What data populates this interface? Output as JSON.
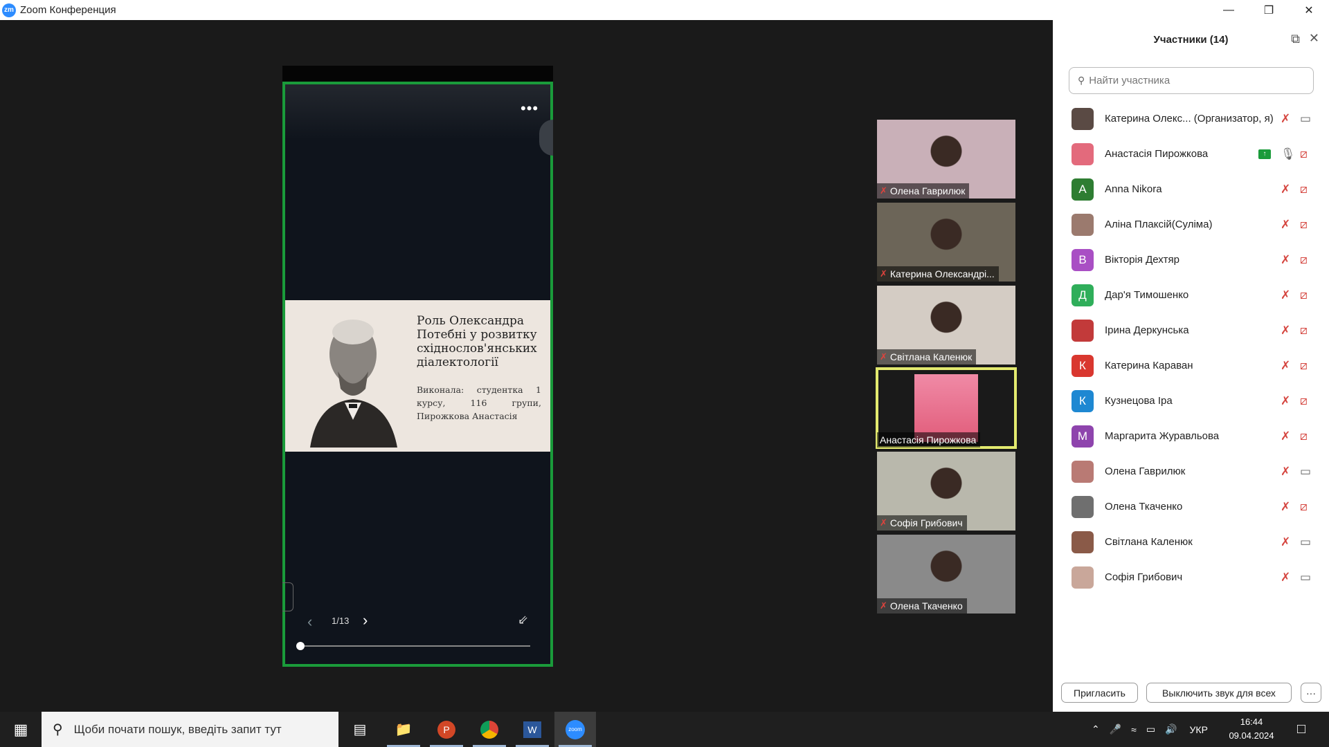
{
  "window": {
    "app_icon": "zm",
    "title": "Zoom Конференция",
    "controls": [
      "minimize-icon",
      "restore-icon",
      "close-icon"
    ]
  },
  "share": {
    "more_icon": "•••",
    "slide_title": "Роль Олександра Потебні у розвитку східнослов'янських діалектології",
    "slide_subtitle": "Виконала: студентка 1 курсу, 116 групи, Пирожкова Анастасія",
    "page_indicator": "1/13",
    "progress": 0.0,
    "frame_color": "#1a9b3a"
  },
  "tiles": [
    {
      "name": "Олена Гаврилюк",
      "muted": true,
      "active": false,
      "bg": "#c9b0b8"
    },
    {
      "name": "Катерина Олександрі...",
      "muted": true,
      "active": false,
      "bg": "#6c6558"
    },
    {
      "name": "Світлана Каленюк",
      "muted": true,
      "active": false,
      "bg": "#d4ccc4"
    },
    {
      "name": "Анастасія Пирожкова",
      "muted": false,
      "active": true,
      "bg": "#e15c7a"
    },
    {
      "name": "Софія Грибович",
      "muted": true,
      "active": false,
      "bg": "#b9b8ac"
    },
    {
      "name": "Олена Ткаченко",
      "muted": true,
      "active": false,
      "bg": "#8a8a8a"
    }
  ],
  "panel": {
    "title": "Участники (14)",
    "search_placeholder": "Найти участника",
    "invite_label": "Пригласить",
    "mute_all_label": "Выключить звук для всех",
    "more_label": "···",
    "participants": [
      {
        "name": "Катерина Олекс... (Организатор, я)",
        "initial": "",
        "color": "#5a4a44",
        "mic": "muted",
        "cam": "on",
        "sharing": false
      },
      {
        "name": "Анастасія Пирожкова",
        "initial": "",
        "color": "#e36a7c",
        "mic": "on",
        "cam": "off",
        "sharing": true
      },
      {
        "name": "Anna Nikora",
        "initial": "A",
        "color": "#2e7d32",
        "mic": "muted",
        "cam": "off",
        "sharing": false
      },
      {
        "name": "Аліна Плаксій(Суліма)",
        "initial": "",
        "color": "#9b7a6e",
        "mic": "muted",
        "cam": "off",
        "sharing": false
      },
      {
        "name": "Вікторія Дехтяр",
        "initial": "В",
        "color": "#a94fc4",
        "mic": "muted",
        "cam": "off",
        "sharing": false
      },
      {
        "name": "Дар'я Тимошенко",
        "initial": "Д",
        "color": "#2fae5a",
        "mic": "muted",
        "cam": "off",
        "sharing": false
      },
      {
        "name": "Ірина Деркунська",
        "initial": "",
        "color": "#c23a3a",
        "mic": "muted",
        "cam": "off",
        "sharing": false
      },
      {
        "name": "Катерина Караван",
        "initial": "К",
        "color": "#d9372f",
        "mic": "muted",
        "cam": "off",
        "sharing": false
      },
      {
        "name": "Кузнецова Іра",
        "initial": "К",
        "color": "#1e88d2",
        "mic": "muted",
        "cam": "off",
        "sharing": false
      },
      {
        "name": "Маргарита Журавльова",
        "initial": "М",
        "color": "#8e44ad",
        "mic": "muted",
        "cam": "off",
        "sharing": false
      },
      {
        "name": "Олена Гаврилюк",
        "initial": "",
        "color": "#b97a74",
        "mic": "muted",
        "cam": "on",
        "sharing": false
      },
      {
        "name": "Олена Ткаченко",
        "initial": "",
        "color": "#6f6f6f",
        "mic": "muted",
        "cam": "off",
        "sharing": false
      },
      {
        "name": "Світлана Каленюк",
        "initial": "",
        "color": "#8a5a48",
        "mic": "muted",
        "cam": "on",
        "sharing": false
      },
      {
        "name": "Софія Грибович",
        "initial": "",
        "color": "#c9a79a",
        "mic": "muted",
        "cam": "on",
        "sharing": false
      }
    ]
  },
  "taskbar": {
    "search_placeholder": "Щоби почати пошук, введіть запит тут",
    "apps": [
      "task-view-icon",
      "file-explorer-icon",
      "powerpoint-icon",
      "chrome-icon",
      "word-icon",
      "zoom-icon"
    ],
    "language": "УКР",
    "time": "16:44",
    "date": "09.04.2024"
  }
}
